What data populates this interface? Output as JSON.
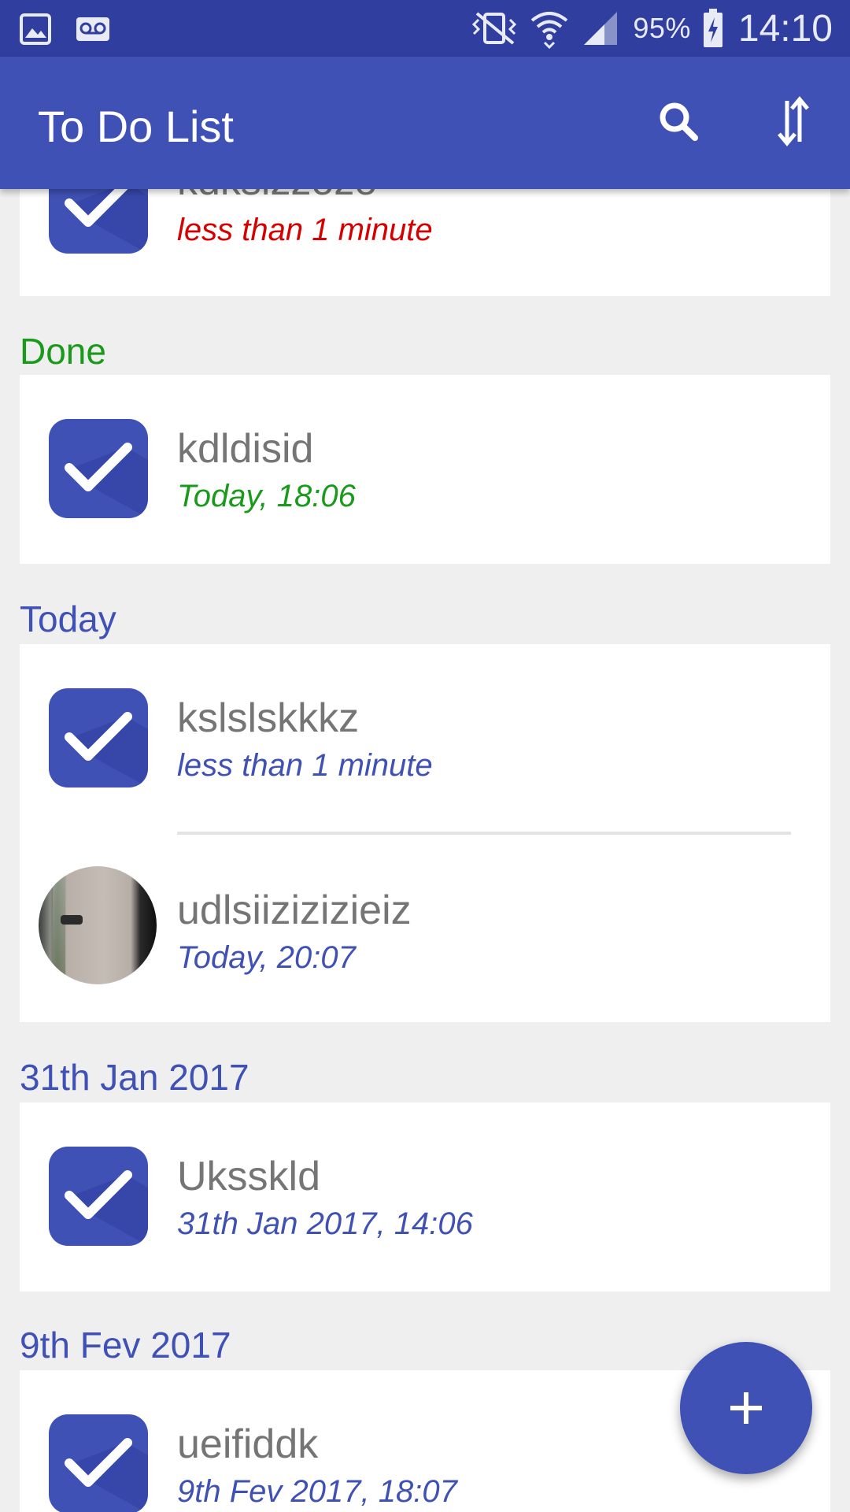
{
  "status_bar": {
    "battery": "95%",
    "time": "14:10",
    "icons": [
      "gallery-notification-icon",
      "voicemail-icon",
      "vibrate-icon",
      "wifi-icon",
      "signal-icon",
      "battery-charging-icon"
    ]
  },
  "app_bar": {
    "title": "To Do List",
    "actions": [
      "search-icon",
      "sort-icon"
    ]
  },
  "colors": {
    "primary": "#3f51b5",
    "primary_dark": "#303f9f",
    "overdue": "#d50000",
    "done": "#1a9a1a",
    "accent_text": "#3f51b5",
    "title_text": "#757575",
    "background": "#efefef"
  },
  "sections": [
    {
      "header": "",
      "items": [
        {
          "title": "kdksizzozo",
          "date": "less than 1 minute",
          "icon": "checkbox-icon"
        }
      ]
    },
    {
      "header": "Done",
      "items": [
        {
          "title": "kdldisid",
          "date": "Today, 18:06",
          "icon": "checkbox-icon"
        }
      ]
    },
    {
      "header": "Today",
      "items": [
        {
          "title": "kslslskkkz",
          "date": "less than 1 minute",
          "icon": "checkbox-icon"
        },
        {
          "title": "udlsiizizizieiz",
          "date": "Today, 20:07",
          "icon": "photo-avatar"
        }
      ]
    },
    {
      "header": "31th Jan 2017",
      "items": [
        {
          "title": "Uksskld",
          "date": "31th Jan 2017, 14:06",
          "icon": "checkbox-icon"
        }
      ]
    },
    {
      "header": "9th Fev 2017",
      "items": [
        {
          "title": "ueifiddk",
          "date": "9th Fev 2017, 18:07",
          "icon": "checkbox-icon"
        }
      ]
    }
  ],
  "fab": {
    "icon": "plus-icon"
  }
}
